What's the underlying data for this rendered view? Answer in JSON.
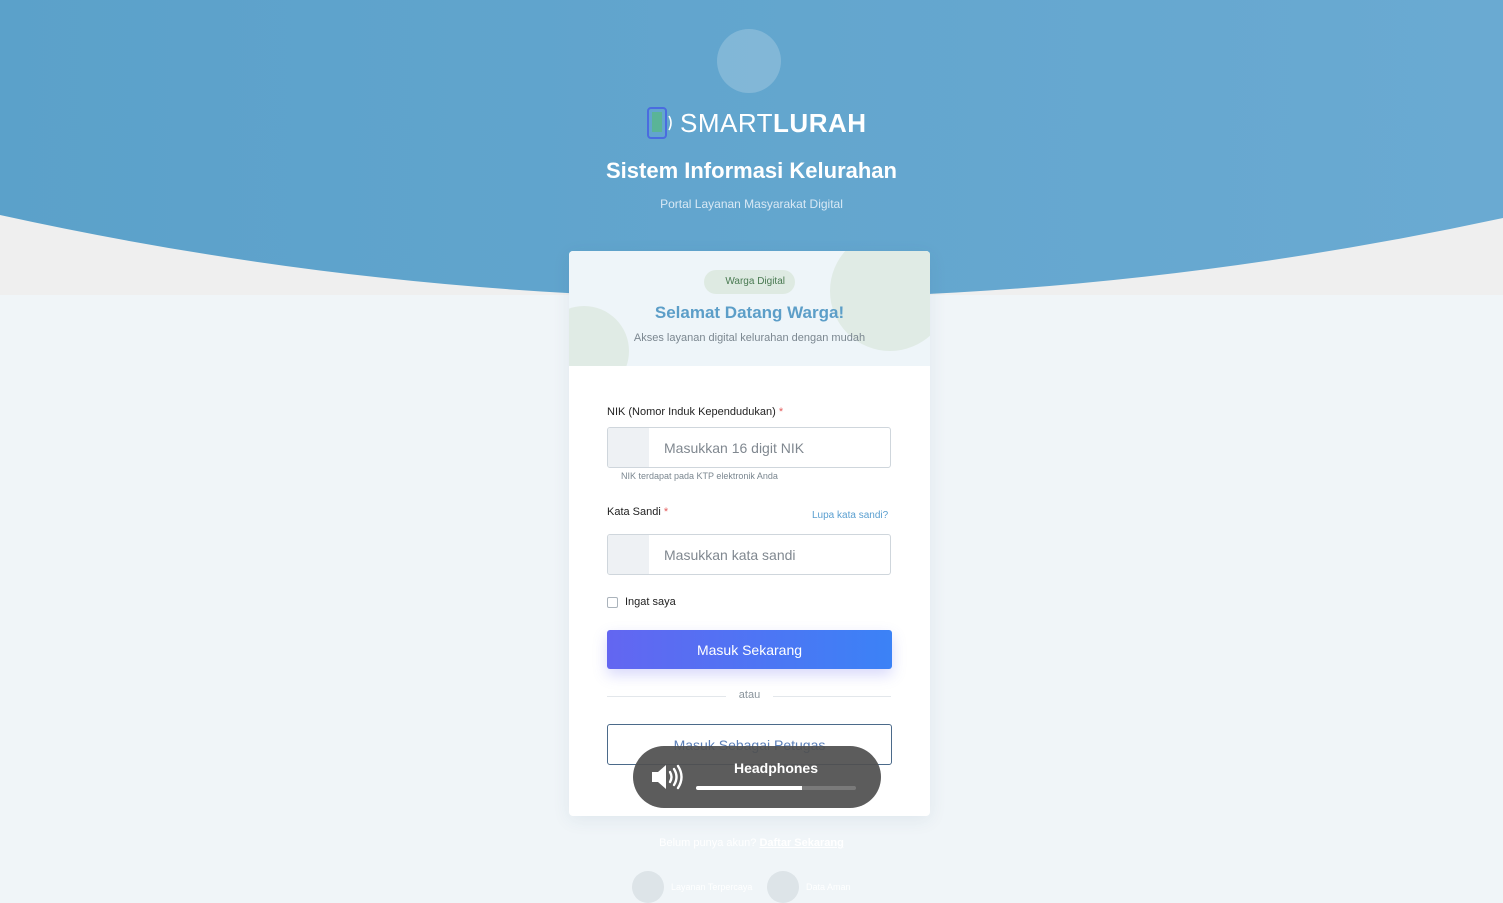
{
  "header": {
    "brand_light": "SMART",
    "brand_bold": "LURAH",
    "title": "Sistem Informasi Kelurahan",
    "subtitle": "Portal Layanan Masyarakat Digital"
  },
  "card": {
    "badge": "Warga Digital",
    "welcome": "Selamat Datang Warga!",
    "welcome_sub": "Akses layanan digital kelurahan dengan mudah"
  },
  "form": {
    "nik_label": "NIK (Nomor Induk Kependudukan)",
    "required_mark": "*",
    "nik_placeholder": "Masukkan 16 digit NIK",
    "nik_hint": "NIK terdapat pada KTP elektronik Anda",
    "password_label": "Kata Sandi",
    "forgot_link": "Lupa kata sandi?",
    "password_placeholder": "Masukkan kata sandi",
    "remember_label": "Ingat saya",
    "submit_label": "Masuk Sekarang",
    "divider": "atau",
    "officer_label": "Masuk Sebagai Petugas"
  },
  "footer": {
    "no_account": "Belum punya akun?",
    "register_link": "Daftar Sekarang",
    "feature_1": "Layanan Terpercaya",
    "feature_2": "Data Aman"
  },
  "volume_osd": {
    "icon": "speaker-volume-icon",
    "device": "Headphones",
    "level_fraction": 0.66
  },
  "colors": {
    "hero": "#5ba1ca",
    "accent": "#5c9ec8",
    "button_gradient_start": "#6366f1",
    "button_gradient_end": "#3b82f6",
    "required": "#e25c5c"
  }
}
